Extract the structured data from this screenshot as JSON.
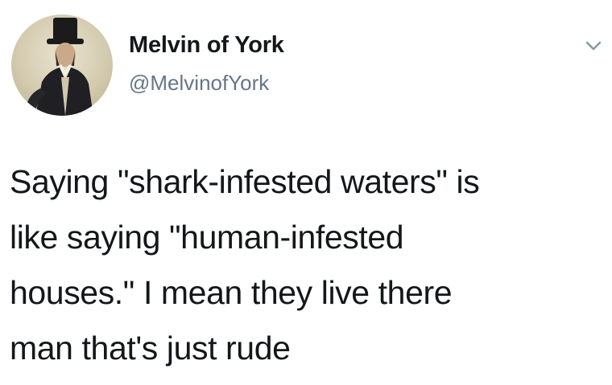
{
  "tweet": {
    "author": {
      "display_name": "Melvin of York",
      "handle": "@MelvinofYork",
      "avatar_icon": "portrait-avatar"
    },
    "menu_icon": "chevron-down-icon",
    "text_lines": [
      "Saying \"shark-infested waters\" is",
      "like saying \"human-infested",
      "houses.\" I mean they live there",
      "man that's just rude"
    ]
  }
}
